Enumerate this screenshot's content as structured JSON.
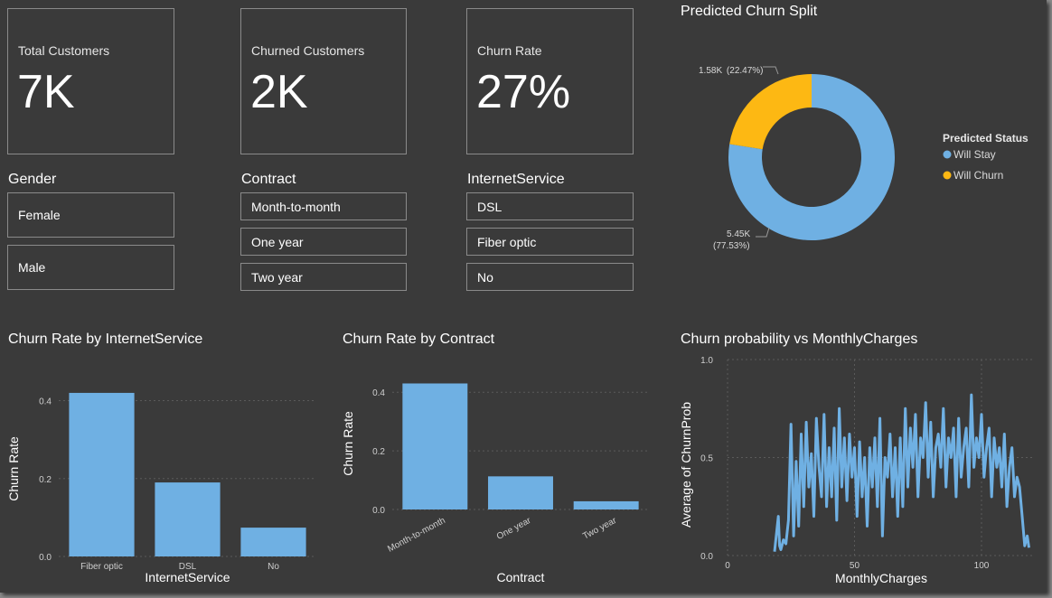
{
  "cards": [
    {
      "label": "Total Customers",
      "value": "7K"
    },
    {
      "label": "Churned Customers",
      "value": "2K"
    },
    {
      "label": "Churn Rate",
      "value": "27%"
    }
  ],
  "slicers": {
    "gender": {
      "title": "Gender",
      "items": [
        "Female",
        "Male"
      ]
    },
    "contract": {
      "title": "Contract",
      "items": [
        "Month-to-month",
        "One year",
        "Two year"
      ]
    },
    "internet": {
      "title": "InternetService",
      "items": [
        "DSL",
        "Fiber optic",
        "No"
      ]
    }
  },
  "colors": {
    "primary": "#6fb0e3",
    "accent": "#fdb813",
    "background": "#3a3a3a"
  },
  "chart_data": [
    {
      "type": "pie",
      "title": "Predicted Churn Split",
      "legend_title": "Predicted Status",
      "legend_position": "right",
      "categories": [
        "Will Stay",
        "Will Churn"
      ],
      "values": [
        5450,
        1580
      ],
      "data_labels": [
        {
          "value": "5.45K",
          "percent": "(77.53%)"
        },
        {
          "value": "1.58K",
          "percent": "(22.47%)"
        }
      ],
      "colors": [
        "#6fb0e3",
        "#fdb813"
      ]
    },
    {
      "type": "bar",
      "title": "Churn Rate by InternetService",
      "categories": [
        "Fiber optic",
        "DSL",
        "No"
      ],
      "values": [
        0.42,
        0.19,
        0.074
      ],
      "xlabel": "InternetService",
      "ylabel": "Churn Rate",
      "ylim": [
        0,
        0.45
      ],
      "yticks": [
        "0.0",
        "0.2",
        "0.4"
      ],
      "grid": true
    },
    {
      "type": "bar",
      "title": "Churn Rate by Contract",
      "categories": [
        "Month-to-month",
        "One year",
        "Two year"
      ],
      "values": [
        0.43,
        0.113,
        0.028
      ],
      "xlabel": "Contract",
      "ylabel": "Churn Rate",
      "ylim": [
        0,
        0.45
      ],
      "yticks": [
        "0.0",
        "0.2",
        "0.4"
      ],
      "grid": true
    },
    {
      "type": "line",
      "title": "Churn probability vs MonthlyCharges",
      "xlabel": "MonthlyCharges",
      "ylabel": "Average of ChurnProb",
      "xlim": [
        0,
        121
      ],
      "ylim": [
        0,
        1.0
      ],
      "xticks": [
        "0",
        "50",
        "100"
      ],
      "yticks": [
        "0.0",
        "0.5",
        "1.0"
      ],
      "grid": true,
      "series": [
        {
          "x": [
            18.5,
            20,
            20.5,
            21,
            22,
            23,
            24,
            25,
            26,
            27,
            28,
            29,
            30,
            31,
            32,
            33,
            34,
            35,
            36,
            37,
            38,
            39,
            40,
            41,
            42,
            43,
            44,
            45,
            46,
            47,
            48,
            49,
            50,
            51,
            52,
            53,
            54,
            55,
            56,
            57,
            58,
            59,
            60,
            61,
            62,
            63,
            64,
            65,
            66,
            67,
            68,
            69,
            70,
            71,
            72,
            73,
            74,
            75,
            76,
            77,
            78,
            79,
            80,
            81,
            82,
            83,
            84,
            85,
            86,
            87,
            88,
            89,
            90,
            91,
            92,
            93,
            94,
            95,
            96,
            97,
            98,
            99,
            100,
            101,
            102,
            103,
            104,
            105,
            106,
            107,
            108,
            109,
            110,
            111,
            112,
            113,
            114,
            115,
            116,
            117,
            118,
            118.7
          ],
          "y": [
            0.02,
            0.2,
            0.05,
            0.03,
            0.08,
            0.06,
            0.18,
            0.67,
            0.1,
            0.48,
            0.15,
            0.62,
            0.25,
            0.68,
            0.35,
            0.52,
            0.2,
            0.7,
            0.45,
            0.3,
            0.72,
            0.25,
            0.55,
            0.3,
            0.65,
            0.18,
            0.75,
            0.35,
            0.6,
            0.28,
            0.62,
            0.4,
            0.55,
            0.2,
            0.58,
            0.3,
            0.5,
            0.15,
            0.55,
            0.35,
            0.6,
            0.25,
            0.7,
            0.1,
            0.5,
            0.4,
            0.62,
            0.3,
            0.55,
            0.2,
            0.6,
            0.25,
            0.75,
            0.35,
            0.65,
            0.45,
            0.72,
            0.3,
            0.6,
            0.5,
            0.78,
            0.4,
            0.68,
            0.3,
            0.55,
            0.62,
            0.45,
            0.75,
            0.35,
            0.6,
            0.5,
            0.65,
            0.3,
            0.7,
            0.4,
            0.55,
            0.65,
            0.35,
            0.82,
            0.45,
            0.6,
            0.5,
            0.72,
            0.4,
            0.55,
            0.65,
            0.3,
            0.6,
            0.45,
            0.55,
            0.35,
            0.62,
            0.25,
            0.45,
            0.55,
            0.3,
            0.4,
            0.35,
            0.2,
            0.05,
            0.1,
            0.04
          ]
        }
      ]
    }
  ]
}
